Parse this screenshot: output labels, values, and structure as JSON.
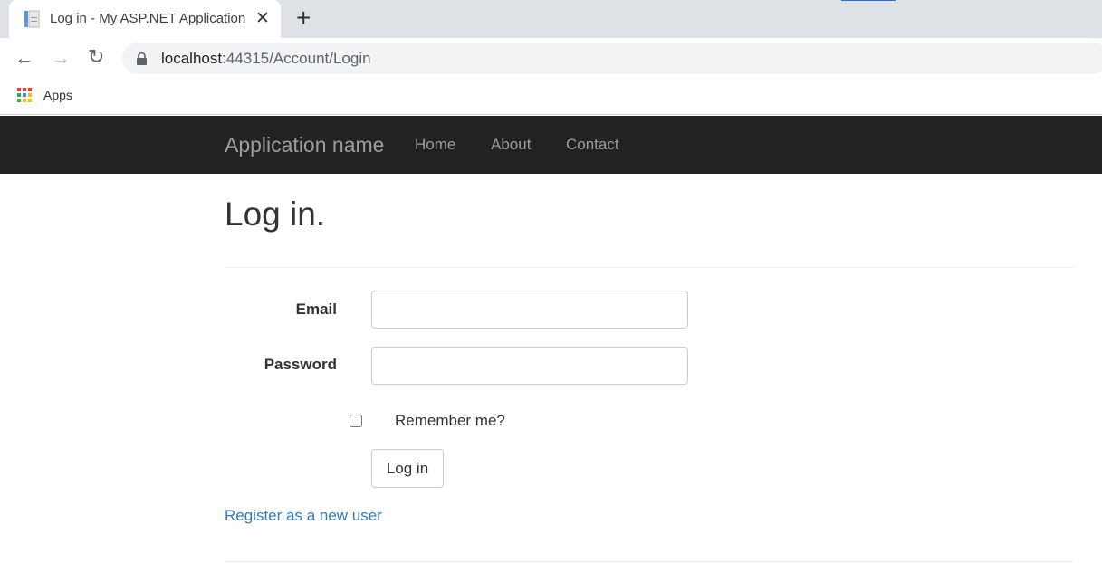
{
  "browser": {
    "tab_title": "Log in - My ASP.NET Application",
    "url_host": "localhost",
    "url_path": ":44315/Account/Login",
    "bookmarks": [
      {
        "label": "Apps"
      }
    ]
  },
  "navbar": {
    "brand": "Application name",
    "links": [
      {
        "label": "Home"
      },
      {
        "label": "About"
      },
      {
        "label": "Contact"
      }
    ]
  },
  "page": {
    "title": "Log in.",
    "email_label": "Email",
    "email_value": "",
    "password_label": "Password",
    "password_value": "",
    "remember_label": "Remember me?",
    "remember_checked": false,
    "submit_label": "Log in",
    "register_link": "Register as a new user"
  },
  "colors": {
    "navbar": "#222222",
    "link": "#337ab7"
  }
}
